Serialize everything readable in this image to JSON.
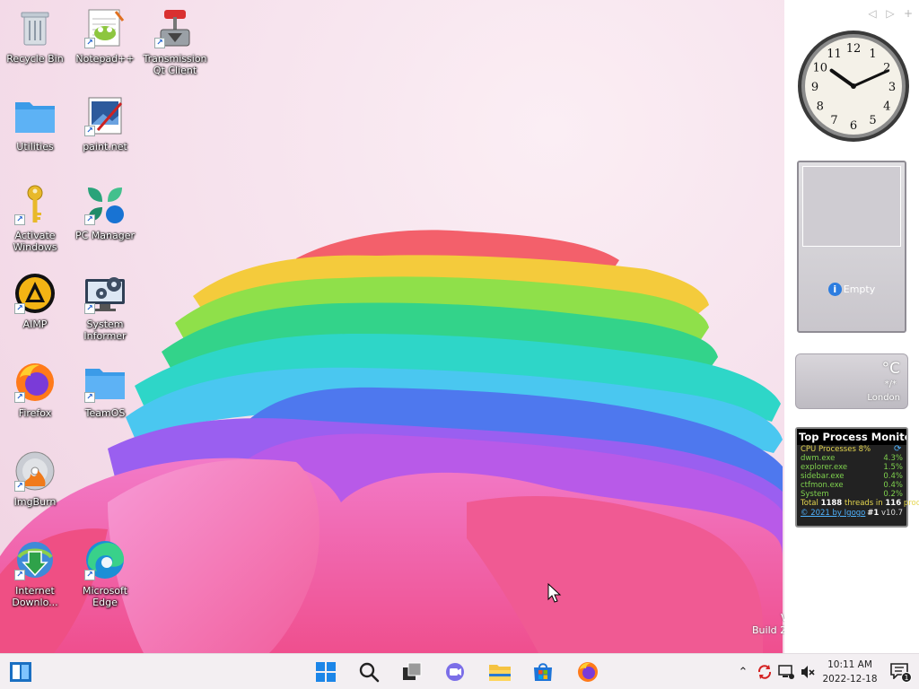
{
  "desktop": {
    "icons": [
      {
        "label": "Recycle Bin"
      },
      {
        "label": "Notepad++"
      },
      {
        "label": "Transmission Qt Client"
      },
      {
        "label": "Utilities"
      },
      {
        "label": "paint.net"
      },
      {
        "label": "Activate Windows"
      },
      {
        "label": "PC Manager"
      },
      {
        "label": "AIMP"
      },
      {
        "label": "System Informer"
      },
      {
        "label": "Firefox"
      },
      {
        "label": "TeamOS"
      },
      {
        "label": "ImgBurn"
      },
      {
        "label": "Internet Downlo..."
      },
      {
        "label": "Microsoft Edge"
      }
    ],
    "build_text_v": "V",
    "build_text": "Build 2"
  },
  "sidebar": {
    "nav_prev": "◁",
    "nav_next": "▷",
    "nav_add": "+",
    "clock_numbers": [
      "12",
      "1",
      "2",
      "3",
      "4",
      "5",
      "6",
      "7",
      "8",
      "9",
      "10",
      "11"
    ],
    "clock_time": {
      "hour": 10,
      "minute": 11
    },
    "slideshow": {
      "status": "Empty",
      "info": "i"
    },
    "weather": {
      "unit": "°C",
      "condition": "*/*",
      "city": "London"
    },
    "top_process_monitor": {
      "title": "Top Process Monitor",
      "header_label": "CPU Processes 8%",
      "processes": [
        {
          "name": "dwm.exe",
          "cpu": "4.3%"
        },
        {
          "name": "explorer.exe",
          "cpu": "1.5%"
        },
        {
          "name": "sidebar.exe",
          "cpu": "0.4%"
        },
        {
          "name": "ctfmon.exe",
          "cpu": "0.4%"
        },
        {
          "name": "System",
          "cpu": "0.2%"
        }
      ],
      "total_prefix": "Total",
      "threads": "1188",
      "threads_label": "threads in",
      "procs": "116",
      "procs_label": "proc",
      "copyright": "© 2021 by Igogo",
      "rank": "#1",
      "version": "v10.7"
    }
  },
  "taskbar": {
    "time": "10:11 AM",
    "date": "2022-12-18",
    "notification_count": "1",
    "pinned": [
      "start-button",
      "search-button",
      "task-view-button",
      "teams-chat-button",
      "file-explorer-button",
      "microsoft-store-button",
      "firefox-taskbar-button"
    ]
  },
  "colors": {
    "accent": "#1a73e8",
    "tpm_green": "#7fd24e",
    "tpm_yellow": "#e5d64f"
  }
}
